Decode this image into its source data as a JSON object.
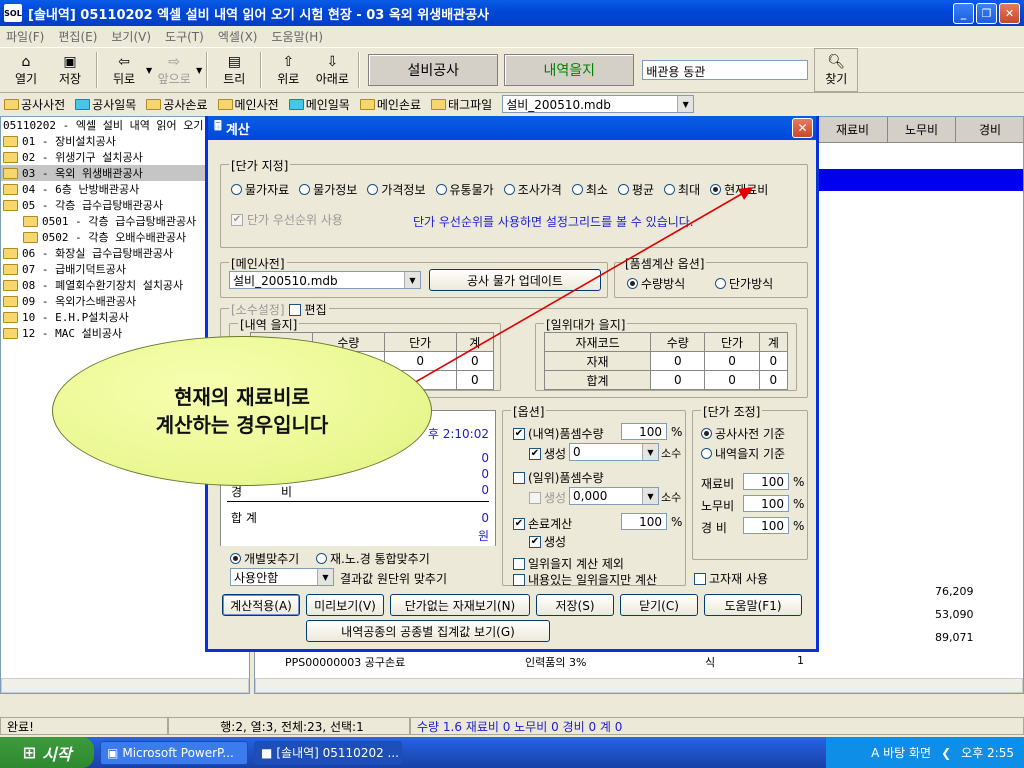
{
  "window": {
    "title": "[솔내역] 05110202 엑셀 설비 내역 읽어 오기 시험 현장 - 03 옥외 위생배관공사",
    "icon_text": "SOL"
  },
  "menu": [
    "파일(F)",
    "편집(E)",
    "보기(V)",
    "도구(T)",
    "엑셀(X)",
    "도움말(H)"
  ],
  "toolbar": {
    "open": "열기",
    "save": "저장",
    "back": "뒤로",
    "forward": "앞으로",
    "tree": "트리",
    "up": "위로",
    "down": "아래로",
    "tab_equipment": "설비공사",
    "tab_statement": "내역을지",
    "search_value": "배관용 동관",
    "find": "찾기"
  },
  "bookbar": {
    "items": [
      "공사사전",
      "공사일목",
      "공사손료",
      "메인사전",
      "메인일목",
      "메인손료",
      "태그파일"
    ],
    "db_value": "설비_200510.mdb"
  },
  "tree": {
    "items": [
      {
        "label": "05110202 - 엑셀 설비 내역 읽어 오기",
        "folder": false,
        "indent": 0
      },
      {
        "label": "01 - 장비설치공사",
        "folder": true,
        "indent": 0
      },
      {
        "label": "02 - 위생기구 설치공사",
        "folder": true,
        "indent": 0
      },
      {
        "label": "03 - 옥외 위생배관공사",
        "folder": true,
        "indent": 0,
        "selected": true
      },
      {
        "label": "04 - 6층 난방배관공사",
        "folder": true,
        "indent": 0
      },
      {
        "label": "05 - 각층 급수급탕배관공사",
        "folder": true,
        "indent": 0
      },
      {
        "label": "0501 - 각층 급수급탕배관공사",
        "folder": true,
        "indent": 1
      },
      {
        "label": "0502 - 각층 오배수배관공사",
        "folder": true,
        "indent": 1
      },
      {
        "label": "06 - 화장실 급수급탕배관공사",
        "folder": true,
        "indent": 0
      },
      {
        "label": "07 - 급배기덕트공사",
        "folder": true,
        "indent": 0
      },
      {
        "label": "08 - 폐열회수환기장치 설치공사",
        "folder": true,
        "indent": 0
      },
      {
        "label": "09 - 옥외가스배관공사",
        "folder": true,
        "indent": 0
      },
      {
        "label": "10 - E.H.P설치공사",
        "folder": true,
        "indent": 0
      },
      {
        "label": "12 - MAC 설비공사",
        "folder": true,
        "indent": 0
      }
    ]
  },
  "grid": {
    "headers": [
      "재료비",
      "노무비",
      "경비"
    ],
    "values": [
      "76,209",
      "53,090",
      "89,071"
    ],
    "last_row": {
      "code": "PPS00000003 공구손료",
      "spec": "인력품의 3%",
      "unit": "식",
      "qty": "1"
    }
  },
  "dialog": {
    "title": "계산",
    "price_group": "[단가 지정]",
    "price_options": [
      "물가자료",
      "물가정보",
      "가격정보",
      "유통물가",
      "조사가격",
      "최소",
      "평균",
      "최대",
      "현재료비"
    ],
    "priority_label": "단가 우선순위 사용",
    "priority_hint": "단가 우선순위를 사용하면 설정그리드를 볼 수 있습니다.",
    "main_dict_group": "[메인사전]",
    "main_dict_value": "설비_200510.mdb",
    "update_button": "공사 물가 업데이트",
    "pum_group": "[품셈계산 옵션]",
    "pum_options": [
      "수량방식",
      "단가방식"
    ],
    "decimal_group": "[소수설정]",
    "edit_label": "편집",
    "stmt_group": "[내역 을지]",
    "stmt_headers": [
      "수량",
      "단가",
      "계"
    ],
    "stmt_rows": [
      [
        "0",
        "0"
      ],
      [
        "0"
      ]
    ],
    "unit_group": "[일위대가 을지]",
    "unit_headers": [
      "자재코드",
      "수량",
      "단가",
      "계"
    ],
    "unit_rows": [
      [
        "자재",
        "0",
        "0",
        "0"
      ],
      [
        "합계",
        "0",
        "0",
        "0"
      ]
    ],
    "summary_time": "후 2:10:02",
    "summary_values": [
      "0",
      "0",
      "0"
    ],
    "summary_partial": "비",
    "summary_partial_prefix": "경",
    "total_label": "합    계",
    "total_value": "0",
    "total_unit": "원",
    "round_options": [
      "개별맞추기",
      "재.노.경 통합맞추기"
    ],
    "round_value": "사용안함",
    "round_suffix": "결과값 원단위 맞추기",
    "opt_group": "[옵션]",
    "opt_stmt_pum": "(내역)품셈수량",
    "opt_stmt_pum_pct": "100",
    "opt_gen": "생성",
    "opt_gen_value": "0",
    "opt_decimal": "소수",
    "opt_unit_pum": "(일위)품셈수량",
    "opt_unit_gen_value": "0,000",
    "opt_loss": "손료계산",
    "opt_loss_pct": "100",
    "opt_exclude": "일위을지 계산 제외",
    "opt_content": "내용있는 일위을지만 계산",
    "pct": "%",
    "adj_group": "[단가 조정]",
    "adj_options": [
      "공사사전 기준",
      "내역을지 기준"
    ],
    "adj_rows": [
      {
        "label": "재료비",
        "value": "100"
      },
      {
        "label": "노무비",
        "value": "100"
      },
      {
        "label": "경  비",
        "value": "100"
      }
    ],
    "fixed_material": "고자재 사용",
    "buttons": [
      "계산적용(A)",
      "미리보기(V)",
      "단가없는 자재보기(N)",
      "저장(S)",
      "닫기(C)",
      "도움말(F1)"
    ],
    "bottom_button": "내역공종의 공종별 집계값 보기(G)"
  },
  "callout": {
    "line1": "현재의 재료비로",
    "line2": "계산하는 경우입니다"
  },
  "status": {
    "ready": "완료!",
    "pos": "행:2, 열:3, 전체:23, 선택:1",
    "summary": "수량 1.6   재료비 0   노무비 0   경비 0   계 0"
  },
  "taskbar": {
    "start": "시작",
    "task1": "Microsoft PowerP...",
    "task2": "[솔내역] 05110202 ...",
    "desktop": "바탕 화면",
    "clock": "오후 2:55"
  },
  "colors": {
    "titlebar": "#0048d8",
    "selection": "#0000ee",
    "callout": "#e9f78f",
    "arrow": "#e00000"
  }
}
